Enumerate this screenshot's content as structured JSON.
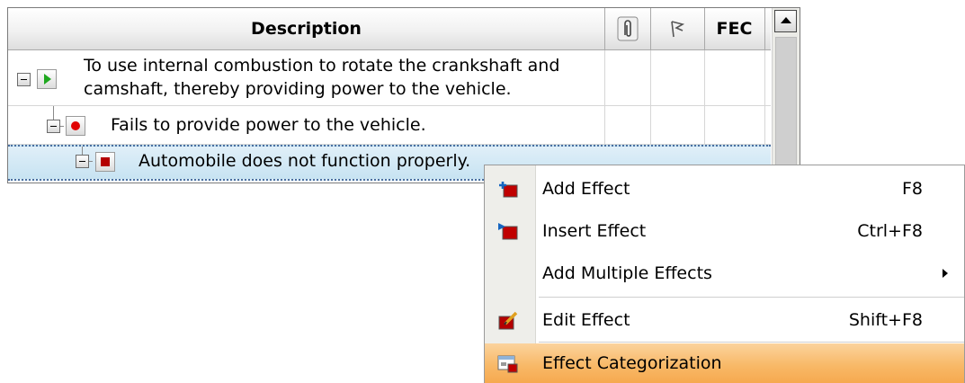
{
  "grid": {
    "columns": {
      "description": "Description",
      "attachment_icon": "paperclip-icon",
      "flag_icon": "flag-icon",
      "fec": "FEC"
    },
    "rows": [
      {
        "icon": "function-play-icon",
        "text_line1": "To use internal combustion to rotate the crankshaft and",
        "text_line2": "camshaft, thereby providing power to the vehicle."
      },
      {
        "icon": "failure-dot-icon",
        "text": "Fails to provide power to the vehicle."
      },
      {
        "icon": "effect-square-icon",
        "text": "Automobile does not function properly.",
        "selected": true
      }
    ]
  },
  "context_menu": {
    "items": [
      {
        "icon": "add-effect-icon",
        "label": "Add Effect",
        "shortcut": "F8"
      },
      {
        "icon": "insert-effect-icon",
        "label": "Insert Effect",
        "shortcut": "Ctrl+F8"
      },
      {
        "label": "Add Multiple Effects",
        "submenu": true
      },
      {
        "icon": "edit-effect-icon",
        "label": "Edit Effect",
        "shortcut": "Shift+F8"
      },
      {
        "icon": "effect-categorization-icon",
        "label": "Effect Categorization",
        "highlighted": true
      }
    ]
  },
  "colors": {
    "highlight": "#f8b968",
    "selection": "#c7e3f2",
    "play_green": "#1fa81f",
    "failure_red": "#e00000",
    "effect_red": "#b40000"
  }
}
